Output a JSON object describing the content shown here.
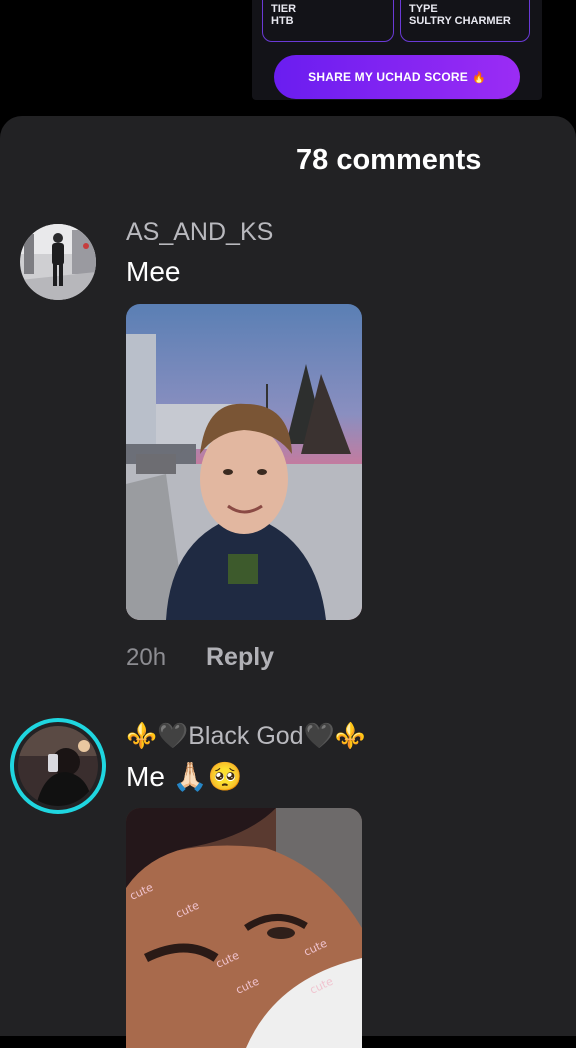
{
  "top_card": {
    "tier_label": "TIER",
    "tier_value": "HTB",
    "type_label": "TYPE",
    "type_value": "SULTRY CHARMER",
    "share_button": "SHARE MY UCHAD SCORE",
    "share_icon": "🔥"
  },
  "comments": {
    "count_label": "78 comments",
    "items": [
      {
        "username": "AS_AND_KS",
        "text": "Mee",
        "time": "20h",
        "reply": "Reply",
        "avatar_icon": "person-standing-photo",
        "media": "selfie-photo-sunset"
      },
      {
        "username": "⚜️🖤Black God🖤⚜️",
        "text": "Me 🙏🏻🥺",
        "avatar_icon": "mirror-selfie-photo",
        "media": "closeup-photo",
        "sticker_words": [
          "cute",
          "cute",
          "cute",
          "cute",
          "cute",
          "cute"
        ]
      }
    ]
  },
  "colors": {
    "sheet_bg": "#222224",
    "accent": "#7b24f2",
    "avatar_ring": "#1fd6e0"
  }
}
